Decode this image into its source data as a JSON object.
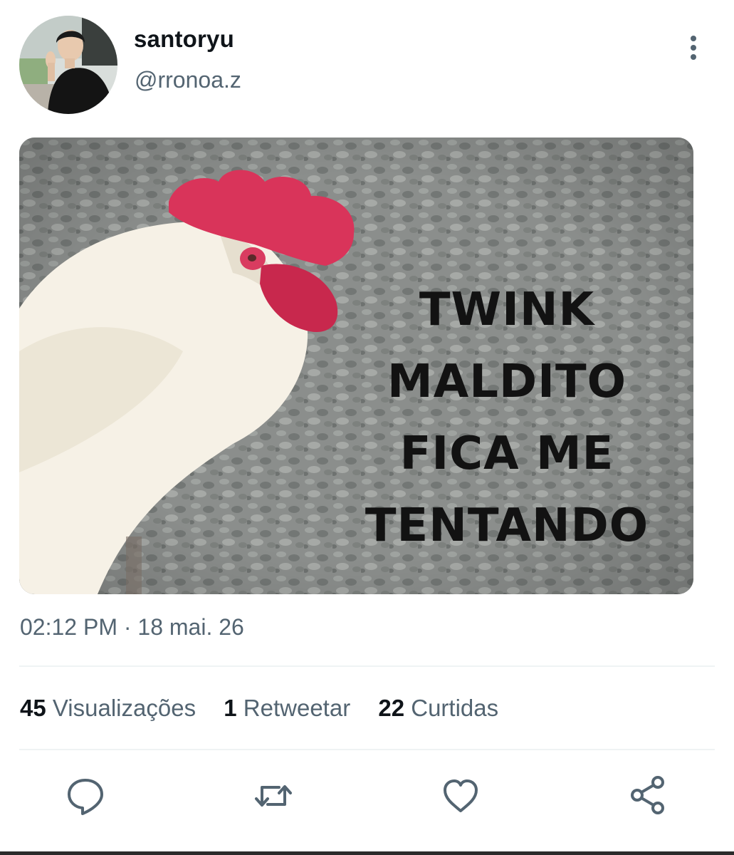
{
  "author": {
    "display_name": "santoryu",
    "handle": "@rronoa.z",
    "avatar_icon": "profile-photo"
  },
  "tweet": {
    "media": {
      "caption_lines": [
        "TWINK",
        "MALDITO",
        "FICA ME",
        "TENTANDO"
      ]
    },
    "timestamp": "02:12 PM · 18 mai. 26"
  },
  "stats": [
    {
      "count": "45",
      "label": "Visualizações"
    },
    {
      "count": "1",
      "label": "Retweetar"
    },
    {
      "count": "22",
      "label": "Curtidas"
    }
  ],
  "actions": [
    {
      "icon": "reply-icon"
    },
    {
      "icon": "retweet-icon"
    },
    {
      "icon": "like-icon"
    },
    {
      "icon": "share-icon"
    }
  ],
  "colors": {
    "text_primary": "#0f1419",
    "text_secondary": "#536471",
    "divider": "#eff3f4",
    "icon": "#536471"
  }
}
